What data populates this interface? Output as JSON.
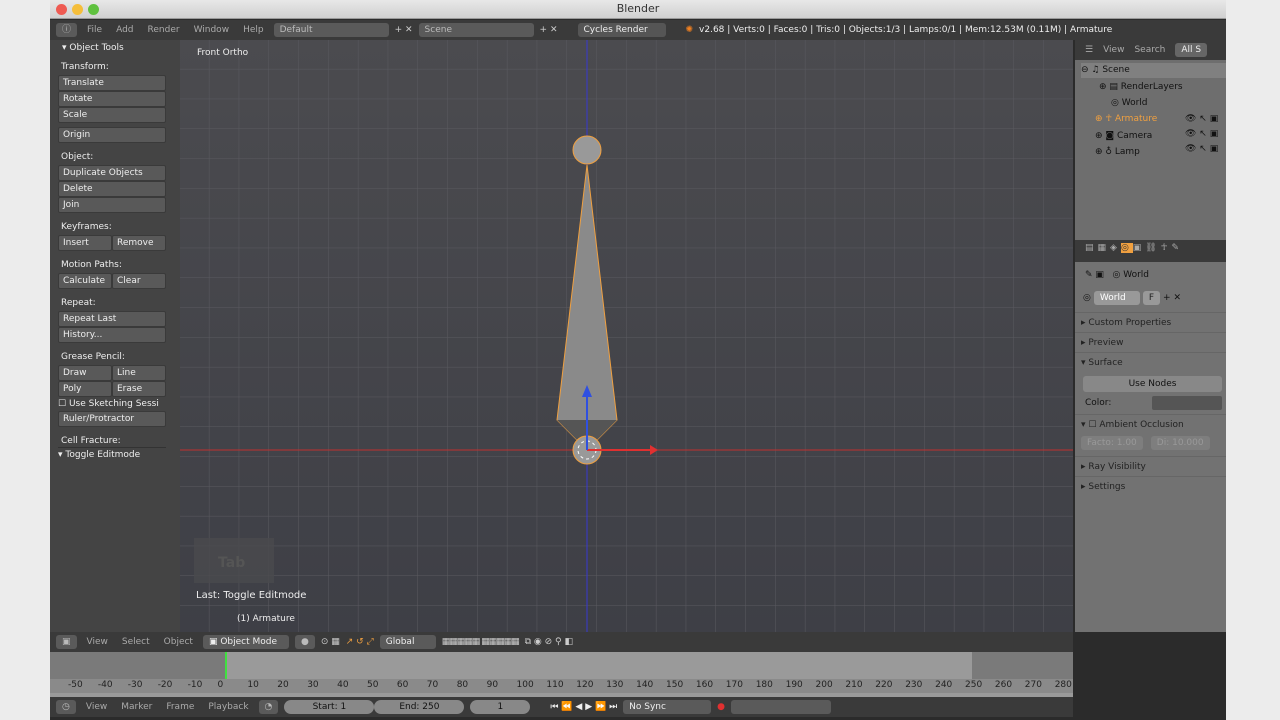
{
  "window": {
    "title": "Blender"
  },
  "top_header": {
    "menus": [
      "File",
      "Add",
      "Render",
      "Window",
      "Help"
    ],
    "layout": "Default",
    "scene": "Scene",
    "engine": "Cycles Render",
    "stats": "v2.68 | Verts:0 | Faces:0 | Tris:0 | Objects:1/3 | Lamps:0/1 | Mem:12.53M (0.11M) | Armature"
  },
  "tools": {
    "title": "Object Tools",
    "transform_label": "Transform:",
    "translate": "Translate",
    "rotate": "Rotate",
    "scale": "Scale",
    "origin": "Origin",
    "object_label": "Object:",
    "duplicate": "Duplicate Objects",
    "delete": "Delete",
    "join": "Join",
    "keyframes_label": "Keyframes:",
    "insert": "Insert",
    "remove": "Remove",
    "motion_label": "Motion Paths:",
    "calculate": "Calculate",
    "clear": "Clear",
    "repeat_label": "Repeat:",
    "repeat_last": "Repeat Last",
    "history": "History...",
    "grease_label": "Grease Pencil:",
    "draw": "Draw",
    "line": "Line",
    "poly": "Poly",
    "erase": "Erase",
    "sketching": "Use Sketching Sessi",
    "ruler": "Ruler/Protractor",
    "cell": "Cell Fracture:",
    "toggle_editmode": "Toggle Editmode"
  },
  "viewport": {
    "view_name": "Front Ortho",
    "last_op": "Last: Toggle Editmode",
    "object_info": "(1) Armature",
    "tab_hint": "Tab",
    "axis_x_color": "#d03030",
    "axis_z_color": "#3030e0",
    "selection_color": "#f0a040"
  },
  "outliner": {
    "view": "View",
    "search": "Search",
    "filter": "All S",
    "items": [
      "Scene",
      "RenderLayers",
      "World",
      "Armature",
      "Camera",
      "Lamp"
    ]
  },
  "properties": {
    "context": "World",
    "world_name": "World",
    "fake_user": "F",
    "sections": {
      "custom": "Custom Properties",
      "preview": "Preview",
      "surface": "Surface",
      "use_nodes": "Use Nodes",
      "color": "Color:",
      "ao": "Ambient Occlusion",
      "factor": "Facto: 1.00",
      "distance": "Di: 10.000",
      "ray": "Ray Visibility",
      "settings": "Settings"
    }
  },
  "view3d_header": {
    "view": "View",
    "select": "Select",
    "object": "Object",
    "mode": "Object Mode",
    "orientation": "Global"
  },
  "timeline": {
    "ticks": [
      "-50",
      "-40",
      "-30",
      "-20",
      "-10",
      "0",
      "10",
      "20",
      "30",
      "40",
      "50",
      "60",
      "70",
      "80",
      "90",
      "100",
      "110",
      "120",
      "130",
      "140",
      "150",
      "160",
      "170",
      "180",
      "190",
      "200",
      "210",
      "220",
      "230",
      "240",
      "250",
      "260",
      "270",
      "280"
    ],
    "current_frame": 1,
    "view": "View",
    "marker": "Marker",
    "frame": "Frame",
    "playback": "Playback",
    "start": "Start: 1",
    "end": "End: 250",
    "frame_field": "1",
    "sync": "No Sync"
  }
}
